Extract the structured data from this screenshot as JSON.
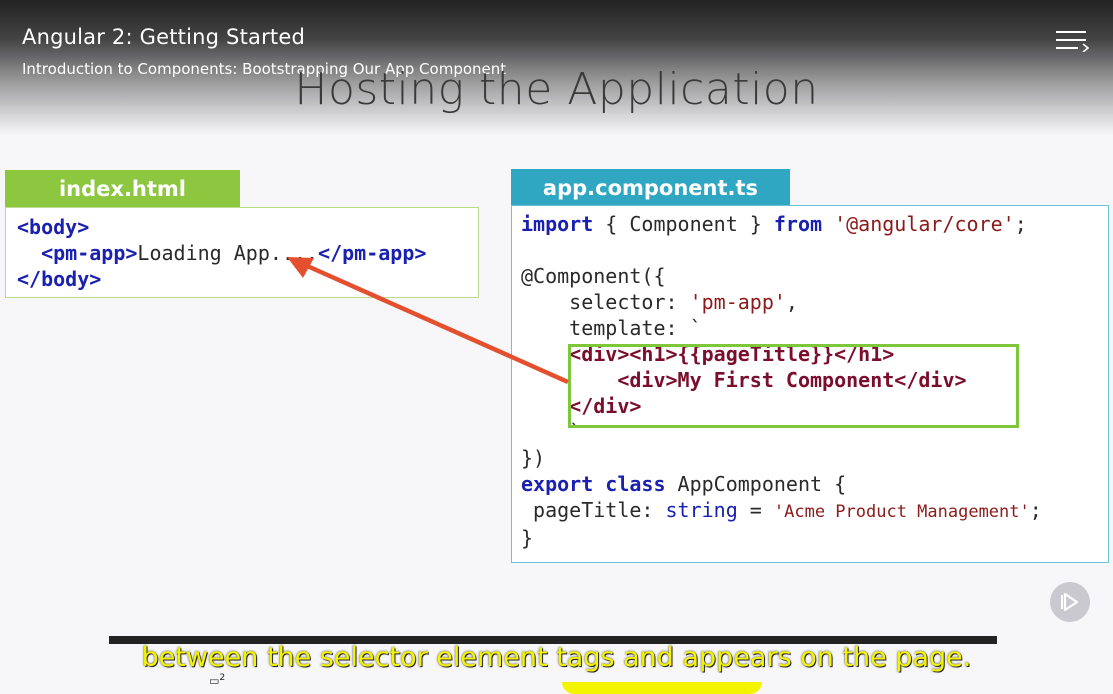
{
  "header": {
    "course_title": "Angular 2: Getting Started",
    "module_title": "Introduction to Components: Bootstrapping Our App Component",
    "menu_icon": "menu-lines-icon"
  },
  "slide": {
    "title": "Hosting the Application",
    "index_tab": "index.html",
    "app_tab": "app.component.ts",
    "index_code": {
      "l1_open": "<body>",
      "l2_open": "<pm-app>",
      "l2_text": "Loading App....",
      "l2_close": "</pm-app>",
      "l3_close": "</body>"
    },
    "app_code": {
      "l1_import": "import",
      "l1_body": " { Component } ",
      "l1_from": "from",
      "l1_str": "'@angular/core'",
      "l1_end": ";",
      "l3": "@Component({",
      "l4_key": "selector: ",
      "l4_val": "'pm-app'",
      "l4_end": ",",
      "l5": "template: `",
      "l6_a": "<div><h1>",
      "l6_b": "{{pageTitle}}",
      "l6_c": "</h1>",
      "l7_a": "<div>",
      "l7_b": "My First Component",
      "l7_c": "</div>",
      "l8": "</div>",
      "l9": "`",
      "l10": "})",
      "l11_kw1": "export",
      "l11_kw2": "class",
      "l11_name": " AppComponent {",
      "l12_key": "pageTitle: ",
      "l12_type": "string",
      "l12_eq": " = ",
      "l12_val": "'Acme Product Management'",
      "l12_end": ";",
      "l13": "}"
    }
  },
  "player": {
    "play_icon": "play-icon",
    "caption": "between the selector element tags and appears on the page.",
    "subtitle_marker": "2",
    "subtitle_icon": "subtitle-icon",
    "caption_color": "#f4f400"
  },
  "colors": {
    "index_tab": "#8dc63f",
    "app_tab": "#2fa7c2",
    "highlight_border": "#7ec63a",
    "arrow": "#e4502f",
    "keyword": "#1a21b0",
    "tag": "#7a0e2c"
  }
}
